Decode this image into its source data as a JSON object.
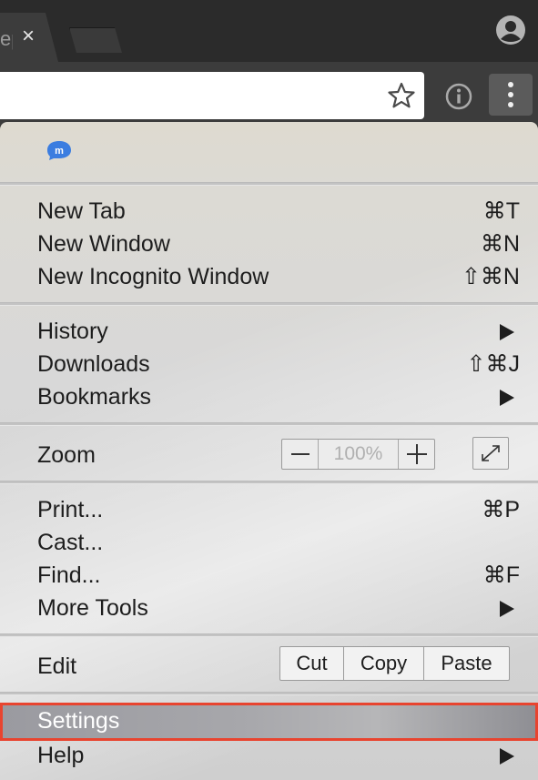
{
  "tab": {
    "title_fragment": "ep",
    "close_glyph": "×"
  },
  "menu": {
    "group1": [
      {
        "label": "New Tab",
        "shortcut": "⌘T"
      },
      {
        "label": "New Window",
        "shortcut": "⌘N"
      },
      {
        "label": "New Incognito Window",
        "shortcut": "⇧⌘N"
      }
    ],
    "group2": [
      {
        "label": "History",
        "submenu": true
      },
      {
        "label": "Downloads",
        "shortcut": "⇧⌘J"
      },
      {
        "label": "Bookmarks",
        "submenu": true
      }
    ],
    "zoom": {
      "label": "Zoom",
      "minus": "—",
      "value": "100%",
      "plus": "+"
    },
    "group4": [
      {
        "label": "Print...",
        "shortcut": "⌘P"
      },
      {
        "label": "Cast..."
      },
      {
        "label": "Find...",
        "shortcut": "⌘F"
      },
      {
        "label": "More Tools",
        "submenu": true
      }
    ],
    "edit": {
      "label": "Edit",
      "cut": "Cut",
      "copy": "Copy",
      "paste": "Paste"
    },
    "settings": {
      "label": "Settings",
      "highlight_color": "#e8442f"
    },
    "help": {
      "label": "Help",
      "submenu": true
    }
  },
  "icons": {
    "extension": "m-extension-icon",
    "star": "star-icon",
    "info": "info-icon",
    "menu": "three-dots-icon",
    "profile": "profile-icon",
    "fullscreen": "fullscreen-icon",
    "submenu": "triangle-right-icon"
  }
}
